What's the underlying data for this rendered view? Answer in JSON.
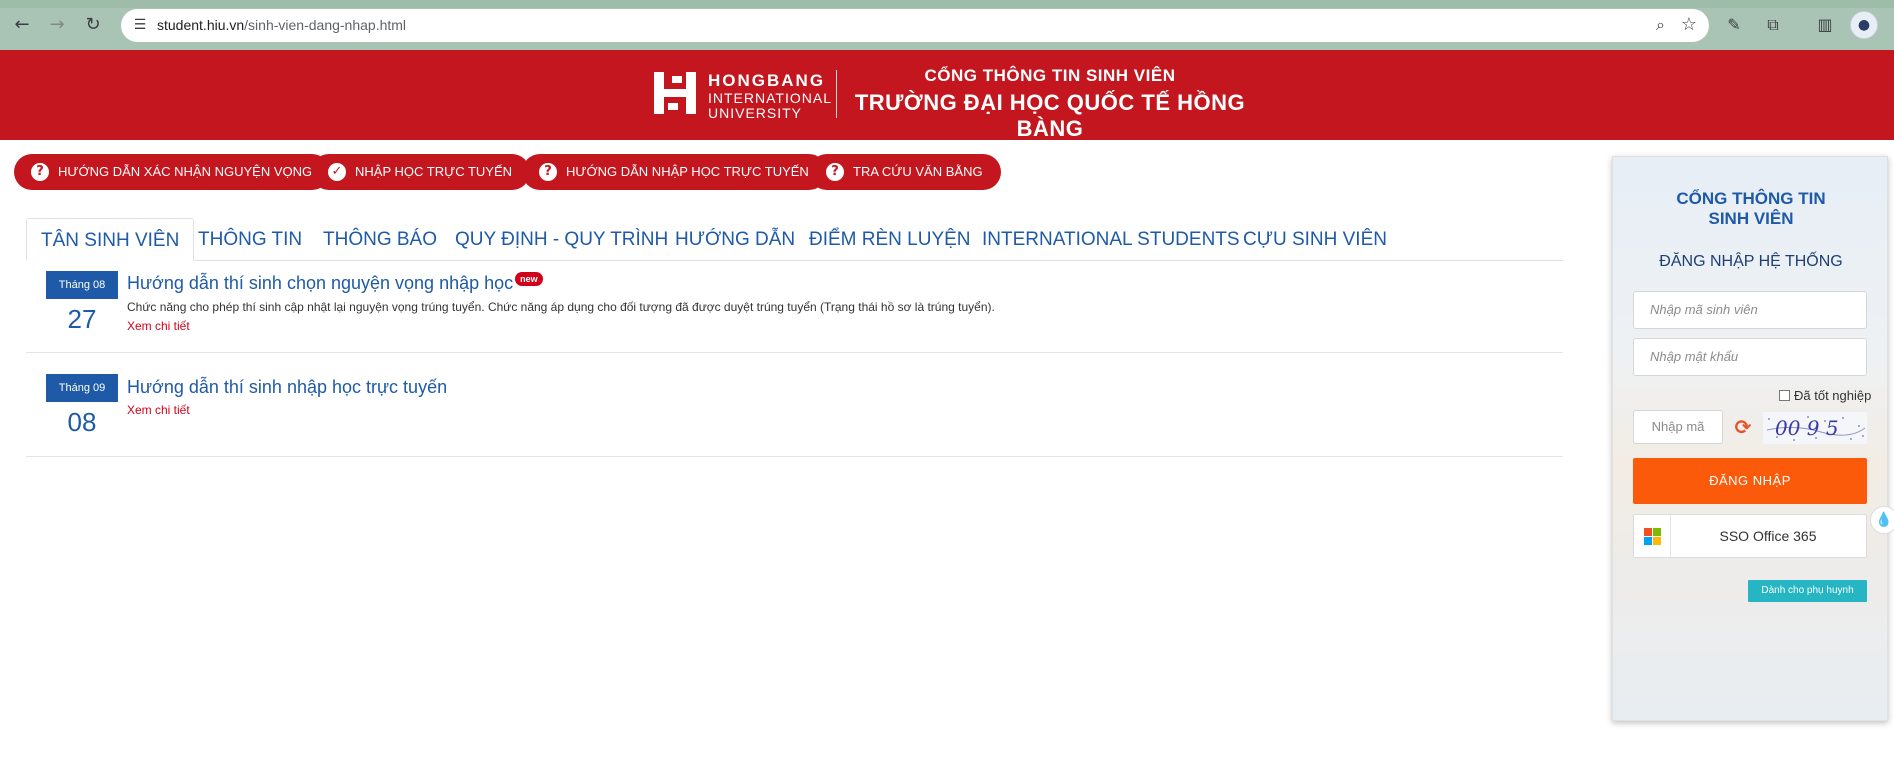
{
  "browser": {
    "url_host": "student.hiu.vn",
    "url_path": "/sinh-vien-dang-nhap.html",
    "icons": [
      "back-icon",
      "forward-icon",
      "reload-icon",
      "site-settings-icon",
      "zoom-icon",
      "star-icon",
      "extension-icon",
      "puzzle-icon",
      "side-panel-icon",
      "profile-icon"
    ]
  },
  "header": {
    "logo_line1": "HONGBANG",
    "logo_line2": "INTERNATIONAL",
    "logo_line3": "UNIVERSITY",
    "title_line1": "CỔNG THÔNG TIN SINH VIÊN",
    "title_line2": "TRƯỜNG ĐẠI HỌC QUỐC TẾ HỒNG BÀNG",
    "brand_color": "#c3161e"
  },
  "quick_buttons": [
    {
      "label": "HƯỚNG DẪN XÁC NHẬN NGUYỆN VỌNG",
      "icon": "question-icon"
    },
    {
      "label": "NHẬP HỌC TRỰC TUYẾN",
      "icon": "check-icon"
    },
    {
      "label": "HƯỚNG DẪN NHẬP HỌC TRỰC TUYẾN",
      "icon": "question-icon"
    },
    {
      "label": "TRA CỨU VĂN BẰNG",
      "icon": "question-icon"
    }
  ],
  "tabs": [
    {
      "label": "TÂN SINH VIÊN",
      "active": true
    },
    {
      "label": "THÔNG TIN"
    },
    {
      "label": "THÔNG BÁO"
    },
    {
      "label": "QUY ĐỊNH - QUY TRÌNH"
    },
    {
      "label": "HƯỚNG DẪN"
    },
    {
      "label": "ĐIỂM RÈN LUYỆN"
    },
    {
      "label": "INTERNATIONAL STUDENTS"
    },
    {
      "label": "CỰU SINH VIÊN"
    }
  ],
  "news": [
    {
      "month": "Tháng 08",
      "day": "27",
      "title": "Hướng dẫn thí sinh chọn nguyện vọng nhập học",
      "badge": "new",
      "description": "Chức năng cho phép thí sinh cập nhật lại nguyện vọng trúng tuyển. Chức năng áp dụng cho đối tượng đã được duyệt trúng tuyển (Trạng thái hồ sơ là trúng tuyển).",
      "more": "Xem chi tiết"
    },
    {
      "month": "Tháng 09",
      "day": "08",
      "title": "Hướng dẫn thí sinh nhập học trực tuyến",
      "more": "Xem chi tiết"
    }
  ],
  "login": {
    "title_line1": "CỔNG THÔNG TIN",
    "title_line2": "SINH VIÊN",
    "subtitle": "ĐĂNG NHẬP HỆ THỐNG",
    "student_id_placeholder": "Nhập mã sinh viên",
    "password_placeholder": "Nhập mật khẩu",
    "graduated_label": "Đã tốt nghiệp",
    "captcha_placeholder": "Nhập mã",
    "captcha_text": "00 9 5",
    "login_button": "ĐĂNG NHẬP",
    "sso_button": "SSO Office 365",
    "parent_button": "Dành cho phụ huynh",
    "accent": "#fb5a0a"
  }
}
